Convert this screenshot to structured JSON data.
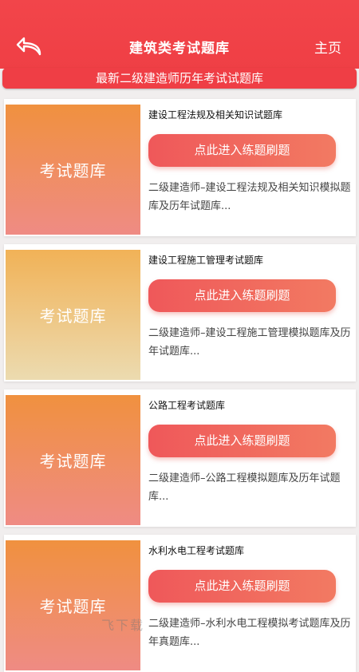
{
  "header": {
    "title": "建筑类考试题库",
    "home_label": "主页"
  },
  "subtitle": "最新二级建造师历年考试试题库",
  "cards": [
    {
      "thumb_label": "考试题库",
      "thumb_gradient": [
        "#f0913f",
        "#ef8b84"
      ],
      "title": "建设工程法规及相关知识试题库",
      "button_label": "点此进入练题刷题",
      "description": "二级建造师–建设工程法规及相关知识模拟题库及历年试题库..."
    },
    {
      "thumb_label": "考试题库",
      "thumb_gradient": [
        "#f1b257",
        "#ecdbb0"
      ],
      "title": "建设工程施工管理考试题库",
      "button_label": "点此进入练题刷题",
      "description": "二级建造师–建设工程施工管理模拟题库及历年试题库..."
    },
    {
      "thumb_label": "考试题库",
      "thumb_gradient": [
        "#f0913f",
        "#ef8b84"
      ],
      "title": "公路工程考试题库",
      "button_label": "点此进入练题刷题",
      "description": "二级建造师–公路工程模拟题库及历年试题库..."
    },
    {
      "thumb_label": "考试题库",
      "thumb_gradient": [
        "#f0913f",
        "#ef8b84"
      ],
      "title": "水利水电工程考试题库",
      "button_label": "点此进入练题刷题",
      "description": "二级建造师–水利水电工程模拟考试题库及历年真题库..."
    }
  ],
  "watermark": "飞下载",
  "colors": {
    "header": "#ef3f45",
    "button_start": "#ef585a",
    "button_end": "#f27a62"
  }
}
